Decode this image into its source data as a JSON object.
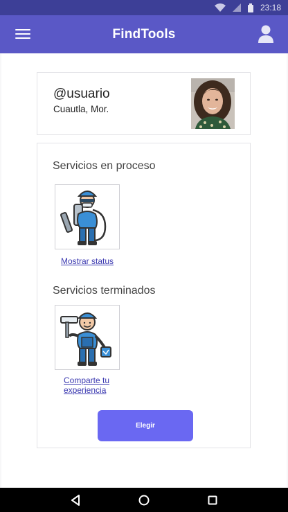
{
  "status_bar": {
    "time": "23:18"
  },
  "app_bar": {
    "title": "FindTools"
  },
  "profile": {
    "username": "@usuario",
    "location": "Cuautla, Mor."
  },
  "services": {
    "in_progress_title": "Servicios en proceso",
    "in_progress_link": "Mostrar status",
    "completed_title": "Servicios terminados",
    "completed_link": "Comparte tu experiencia"
  },
  "choose_button": {
    "label": "Elegir"
  },
  "colors": {
    "app_bar": "#5a58c6",
    "status_bar": "#3d3f97",
    "accent_button": "#6a68f2",
    "link": "#3a38b0"
  },
  "icons": {
    "menu": "hamburger-icon",
    "profile": "person-icon",
    "nav_back": "triangle-back-icon",
    "nav_home": "circle-home-icon",
    "nav_recents": "square-recents-icon"
  }
}
